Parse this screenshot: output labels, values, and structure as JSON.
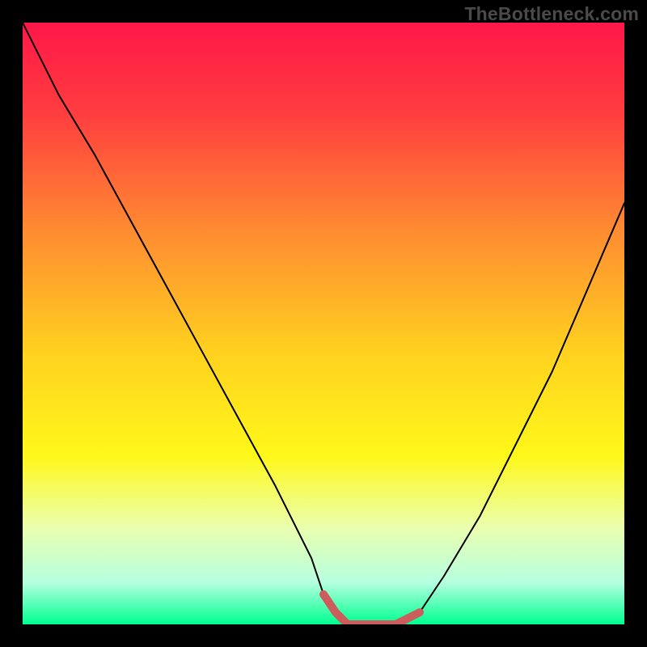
{
  "watermark": "TheBottleneck.com",
  "chart_data": {
    "type": "line",
    "title": "",
    "xlabel": "",
    "ylabel": "",
    "xlim": [
      0,
      100
    ],
    "ylim": [
      0,
      100
    ],
    "grid": false,
    "background_gradient_stops": [
      {
        "offset": 0.0,
        "color": "#ff1749"
      },
      {
        "offset": 0.15,
        "color": "#ff3d3f"
      },
      {
        "offset": 0.35,
        "color": "#ff8d31"
      },
      {
        "offset": 0.55,
        "color": "#ffd21f"
      },
      {
        "offset": 0.72,
        "color": "#fff81a"
      },
      {
        "offset": 0.84,
        "color": "#eaffb0"
      },
      {
        "offset": 0.93,
        "color": "#b6ffe0"
      },
      {
        "offset": 1.0,
        "color": "#00ff90"
      }
    ],
    "series": [
      {
        "name": "bottleneck-curve",
        "stroke": "#000000",
        "stroke_width": 2,
        "x": [
          0,
          6,
          12,
          18,
          24,
          30,
          36,
          42,
          48,
          50,
          54,
          58,
          62,
          66,
          70,
          76,
          82,
          88,
          94,
          100
        ],
        "y": [
          100,
          88,
          78,
          67,
          56,
          45,
          34,
          23,
          11,
          5,
          0,
          0,
          0,
          2,
          8,
          18,
          30,
          42,
          56,
          70
        ]
      },
      {
        "name": "optimal-marker",
        "stroke": "#cd5c5c",
        "stroke_width": 10,
        "x": [
          50,
          52,
          54,
          56,
          58,
          60,
          62,
          64,
          66
        ],
        "y": [
          5,
          2,
          0,
          0,
          0,
          0,
          0,
          1,
          2
        ]
      }
    ]
  }
}
